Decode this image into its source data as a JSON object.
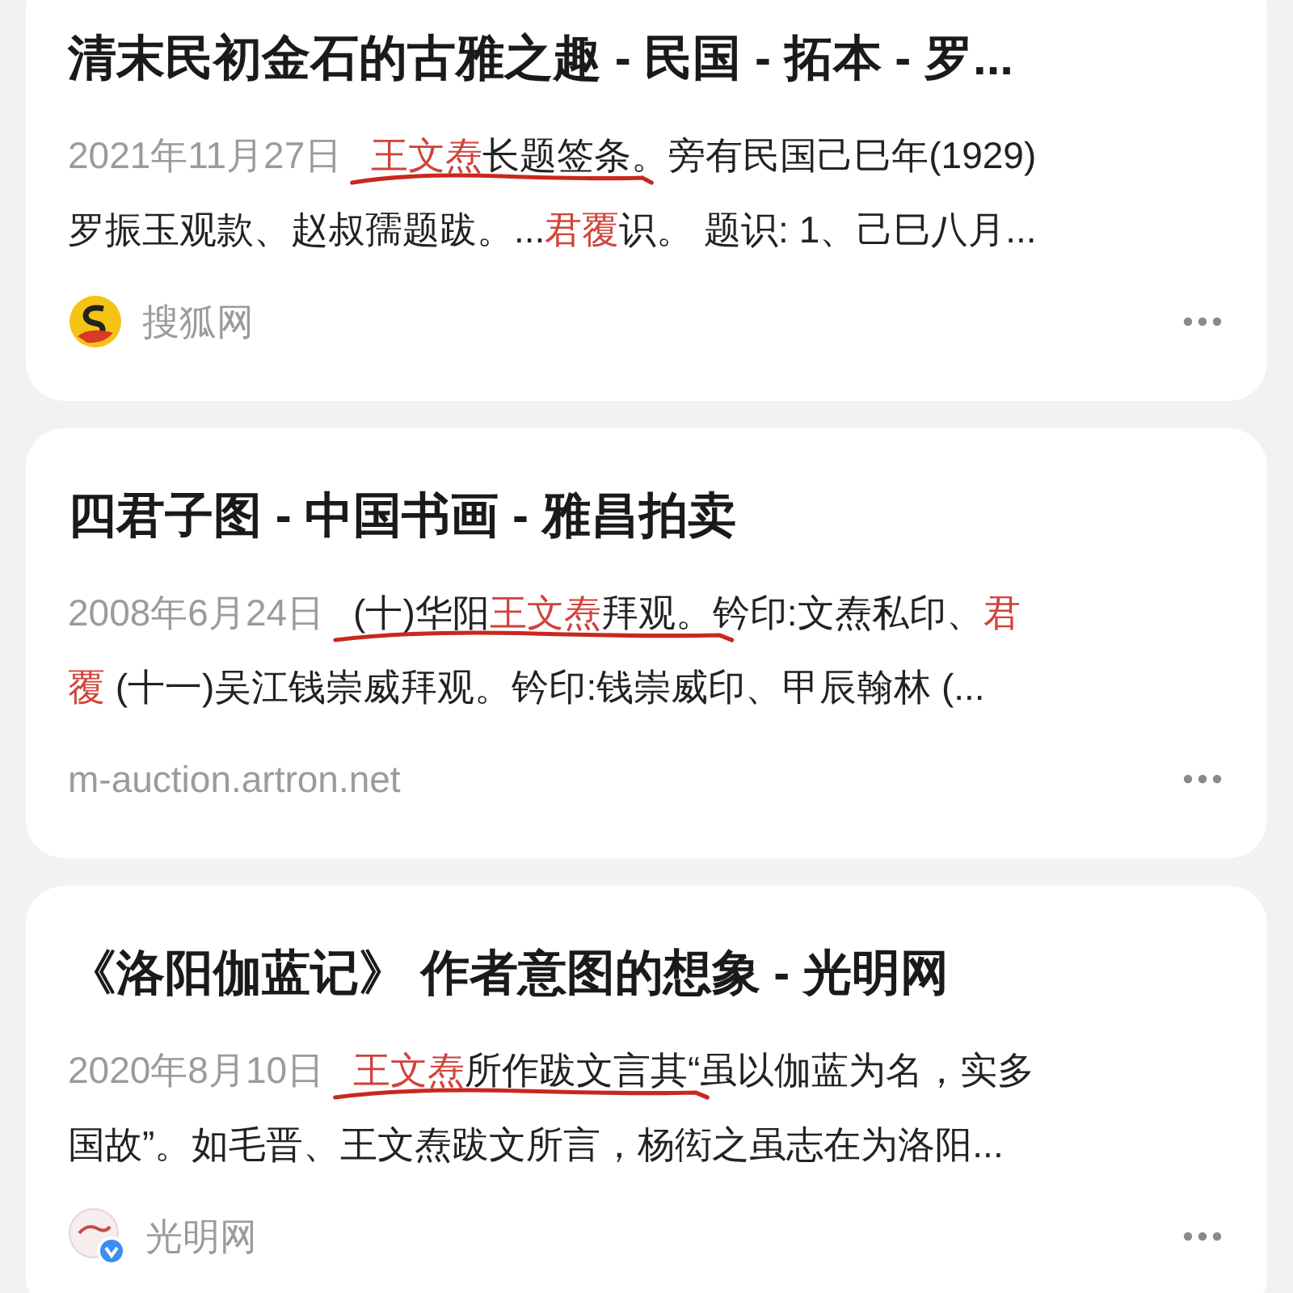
{
  "results": [
    {
      "title": "清末民初金石的古雅之趣 - 民国 - 拓本 - 罗...",
      "date": "2021年11月27日",
      "marked": "**王文焘**长题签条",
      "rest": "。旁有民国己巳年(1929)",
      "more_lines": [
        "罗振玉观款、赵叔孺题跋。...**君覆**识。 题识: 1、己巳八月..."
      ],
      "hand_underlined": true,
      "source": {
        "kind": "sohu",
        "name": "搜狐网"
      }
    },
    {
      "title": "四君子图 - 中国书画 - 雅昌拍卖",
      "date": "2008年6月24日",
      "marked": "(十)华阳**王文焘**拜观。",
      "rest": "钤印:文焘私印、**君**",
      "more_lines": [
        "**覆** (十一)吴江钱崇威拜观。钤印:钱崇威印、甲辰翰林 (..."
      ],
      "hand_underlined": true,
      "source": {
        "kind": "url",
        "name": "m-auction.artron.net"
      }
    },
    {
      "title": "《洛阳伽蓝记》 作者意图的想象 - 光明网",
      "date": "2020年8月10日",
      "marked": "**王文焘**所作跋文言其",
      "rest": "“虽以伽蓝为名，实多",
      "more_lines": [
        "国故”。如毛晋、王文焘跋文所言，杨衒之虽志在为洛阳..."
      ],
      "hand_underlined": true,
      "source": {
        "kind": "verified",
        "name": "光明网"
      }
    }
  ]
}
